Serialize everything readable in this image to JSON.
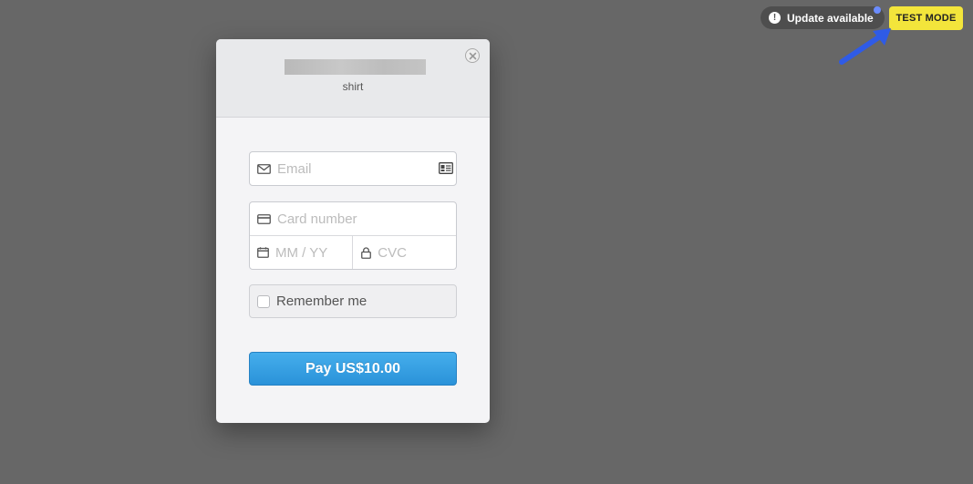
{
  "topbar": {
    "update_label": "Update available",
    "test_mode_label": "TEST MODE"
  },
  "colors": {
    "background": "#676767",
    "test_mode_badge": "#f3e53b",
    "pay_button": "#3aa3e5",
    "annotation_arrow": "#2f5be6",
    "update_dot": "#6b8cff"
  },
  "modal": {
    "merchant_name": "",
    "product_description": "shirt",
    "email": {
      "value": "",
      "placeholder": "Email"
    },
    "card_number": {
      "value": "",
      "placeholder": "Card number"
    },
    "expiry": {
      "value": "",
      "placeholder": "MM / YY"
    },
    "cvc": {
      "value": "",
      "placeholder": "CVC"
    },
    "remember_me": {
      "label": "Remember me",
      "checked": false
    },
    "pay_button_label": "Pay US$10.00"
  },
  "icons": {
    "email": "envelope-icon",
    "contact_card": "id-card-icon",
    "card": "credit-card-icon",
    "expiry": "calendar-icon",
    "cvc": "lock-icon",
    "close": "close-icon",
    "alert": "alert-icon",
    "arrow": "arrow-icon"
  }
}
